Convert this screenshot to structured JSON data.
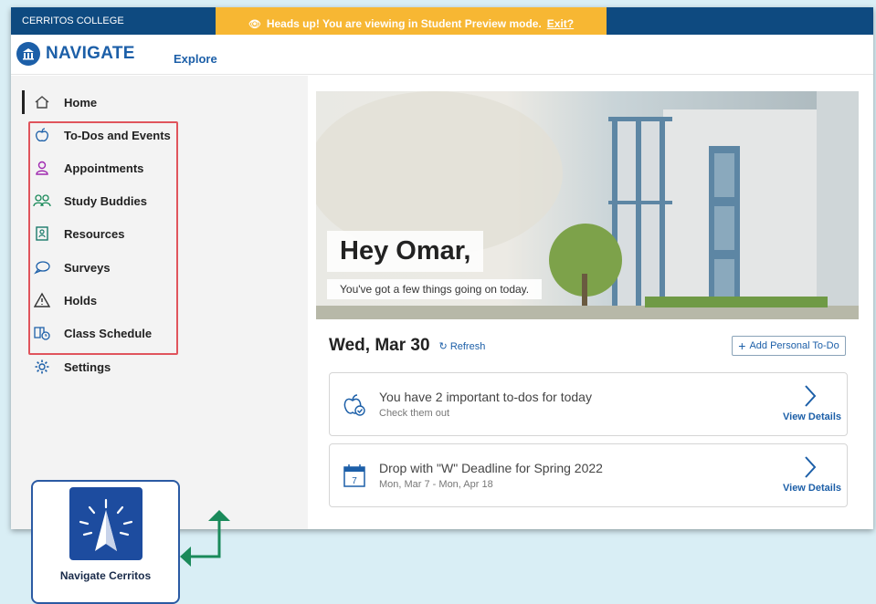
{
  "topbar": {
    "college": "CERRITOS COLLEGE"
  },
  "banner": {
    "text": "Heads up! You are viewing in Student Preview mode.",
    "exit": "Exit?"
  },
  "header": {
    "logo": "NAVIGATE",
    "explore": "Explore"
  },
  "sidebar": {
    "items": [
      {
        "label": "Home",
        "icon": "home-icon"
      },
      {
        "label": "To-Dos and Events",
        "icon": "apple-icon"
      },
      {
        "label": "Appointments",
        "icon": "person-icon"
      },
      {
        "label": "Study Buddies",
        "icon": "people-icon"
      },
      {
        "label": "Resources",
        "icon": "contact-card-icon"
      },
      {
        "label": "Surveys",
        "icon": "speech-bubble-icon"
      },
      {
        "label": "Holds",
        "icon": "warning-icon"
      },
      {
        "label": "Class Schedule",
        "icon": "book-clock-icon"
      },
      {
        "label": "Settings",
        "icon": "gear-icon"
      }
    ]
  },
  "hero": {
    "greeting": "Hey Omar,",
    "subtitle": "You've got a few things going on today."
  },
  "day": {
    "date": "Wed, Mar 30",
    "refresh": "Refresh",
    "add_todo": "Add Personal To-Do"
  },
  "cards": [
    {
      "title": "You have 2 important to-dos for today",
      "subtitle": "Check them out",
      "action": "View Details",
      "icon": "apple-check-icon"
    },
    {
      "title": "Drop with \"W\" Deadline for Spring 2022",
      "subtitle": "Mon, Mar 7 - Mon, Apr 18",
      "action": "View Details",
      "icon": "calendar-icon",
      "calendar_day": "7"
    }
  ],
  "app_tile": {
    "name": "Navigate Cerritos"
  },
  "colors": {
    "brand": "#1c5fa8",
    "banner": "#f7b733",
    "highlight": "#e0545c",
    "arrow": "#1a8a5a"
  }
}
